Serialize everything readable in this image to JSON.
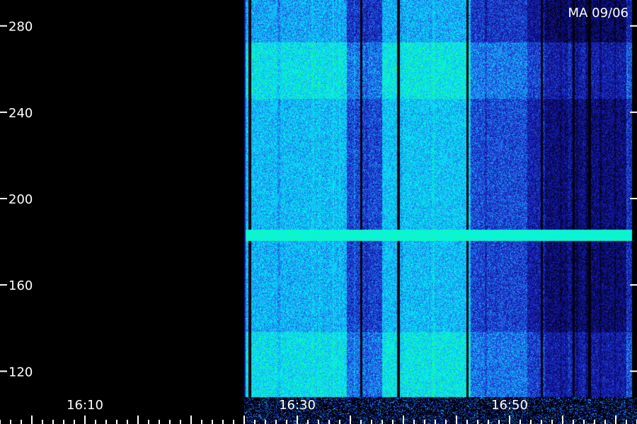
{
  "chart_data": {
    "type": "heatmap",
    "station_label": "MA 09/06",
    "y_axis": {
      "ticks": [
        280,
        240,
        200,
        160,
        120
      ],
      "ylim": [
        108,
        292
      ]
    },
    "x_axis": {
      "tick_labels": [
        "16:10",
        "16:30",
        "16:50"
      ],
      "xlim_minutes": [
        962,
        1022
      ]
    },
    "data_start_minute": 985,
    "dark_gaps_minutes": [
      985.5,
      996.0,
      999.5,
      1006.0,
      1013.0,
      1016.0,
      1017.5
    ],
    "persistent_band_y": 183,
    "colormap": [
      "#000000",
      "#0a0a6e",
      "#1e28d2",
      "#1e9bf0",
      "#00f0ff",
      "#28ff64"
    ]
  }
}
